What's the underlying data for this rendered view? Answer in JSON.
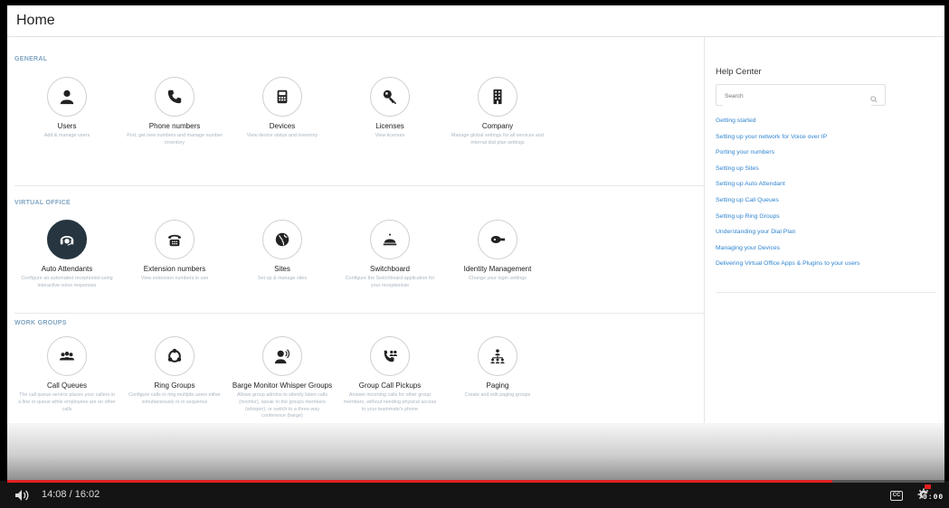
{
  "page": {
    "title": "Home"
  },
  "sections": [
    {
      "title": "GENERAL"
    },
    {
      "title": "VIRTUAL OFFICE"
    },
    {
      "title": "WORK GROUPS"
    }
  ],
  "tiles": [
    {
      "name": "Users",
      "desc": "Add & manage users",
      "icon": "user-icon"
    },
    {
      "name": "Phone numbers",
      "desc": "Port, get new numbers and manage number inventory",
      "icon": "phone-icon"
    },
    {
      "name": "Devices",
      "desc": "View device status and inventory",
      "icon": "desk-phone-icon"
    },
    {
      "name": "Licenses",
      "desc": "View licenses",
      "icon": "key-icon"
    },
    {
      "name": "Company",
      "desc": "Manage global settings for all services and internal dial plan settings",
      "icon": "building-icon"
    },
    {
      "name": "Auto Attendants",
      "desc": "Configure an automated receptionist using interactive voice responses",
      "icon": "auto-attendant-icon"
    },
    {
      "name": "Extension numbers",
      "desc": "View extension numbers in use",
      "icon": "dialpad-phone-icon"
    },
    {
      "name": "Sites",
      "desc": "Set up & manage sites",
      "icon": "globe-icon"
    },
    {
      "name": "Switchboard",
      "desc": "Configure the Switchboard application for your receptionists",
      "icon": "bell-icon"
    },
    {
      "name": "Identity Management",
      "desc": "Change your login settings",
      "icon": "id-key-icon"
    },
    {
      "name": "Call Queues",
      "desc": "The call queue service places your callers in a line or queue while employees are on other calls",
      "icon": "group-icon"
    },
    {
      "name": "Ring Groups",
      "desc": "Configure calls to ring multiple users either simultaneously or in sequence",
      "icon": "ring-group-icon"
    },
    {
      "name": "Barge Monitor Whisper Groups",
      "desc": "Allows group admins to silently listen calls (monitor), speak to the groups members (whisper), or switch to a three-way conference (barge)",
      "icon": "speaking-user-icon"
    },
    {
      "name": "Group Call Pickups",
      "desc": "Answer incoming calls for other group members, without needing physical access to your teammate's phone",
      "icon": "call-pickup-icon"
    },
    {
      "name": "Paging",
      "desc": "Create and edit paging groups",
      "icon": "paging-icon"
    }
  ],
  "help": {
    "title": "Help Center",
    "search_placeholder": "Search",
    "links": [
      "Getting started",
      "Setting up your network for Voice over IP",
      "Porting your numbers",
      "Setting up Sites",
      "Setting up Auto Attendant",
      "Setting up Call Queues",
      "Setting up Ring Groups",
      "Understanding your Dial Plan",
      "Managing your Devices",
      "Delivering Virtual Office Apps & Plugins to your users"
    ]
  },
  "player": {
    "time": "14:08 / 16:02",
    "progress": 0.88,
    "cc_label": "CC",
    "clock_overlay": "0:00"
  },
  "colors": {
    "link": "#2f84d0",
    "section_title": "#7fa4c2",
    "active_tile": "#26353f",
    "progress": "#e02020"
  }
}
